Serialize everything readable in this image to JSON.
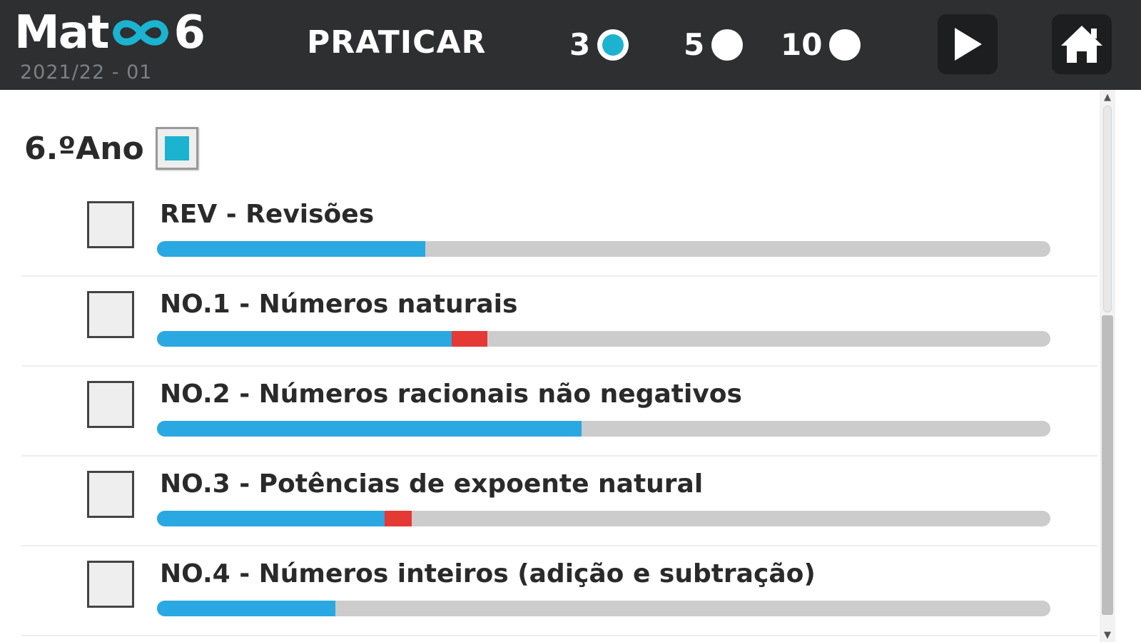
{
  "app": {
    "logo_text_left": "Mat",
    "logo_text_right": "6",
    "version": "2021/22 - 01"
  },
  "header": {
    "mode_label": "PRATICAR",
    "options": [
      {
        "label": "3",
        "selected": true
      },
      {
        "label": "5",
        "selected": false
      },
      {
        "label": "10",
        "selected": false
      }
    ],
    "play_icon": "play-icon",
    "home_icon": "home-icon"
  },
  "year": {
    "label": "6.ºAno",
    "checked": true
  },
  "topics": [
    {
      "label": "REV - Revisões",
      "checked": false,
      "progress_correct": 0.3,
      "progress_wrong": 0.0
    },
    {
      "label": "NO.1 - Números naturais",
      "checked": false,
      "progress_correct": 0.33,
      "progress_wrong": 0.04
    },
    {
      "label": "NO.2 - Números racionais não negativos",
      "checked": false,
      "progress_correct": 0.475,
      "progress_wrong": 0.0
    },
    {
      "label": "NO.3 - Potências de expoente natural",
      "checked": false,
      "progress_correct": 0.255,
      "progress_wrong": 0.03
    },
    {
      "label": "NO.4 - Números inteiros (adição e subtração)",
      "checked": false,
      "progress_correct": 0.2,
      "progress_wrong": 0.0
    }
  ],
  "colors": {
    "accent": "#1bb3cf",
    "progress_correct": "#2aa8e2",
    "progress_wrong": "#e53935",
    "header_bg": "#2d2f31"
  }
}
